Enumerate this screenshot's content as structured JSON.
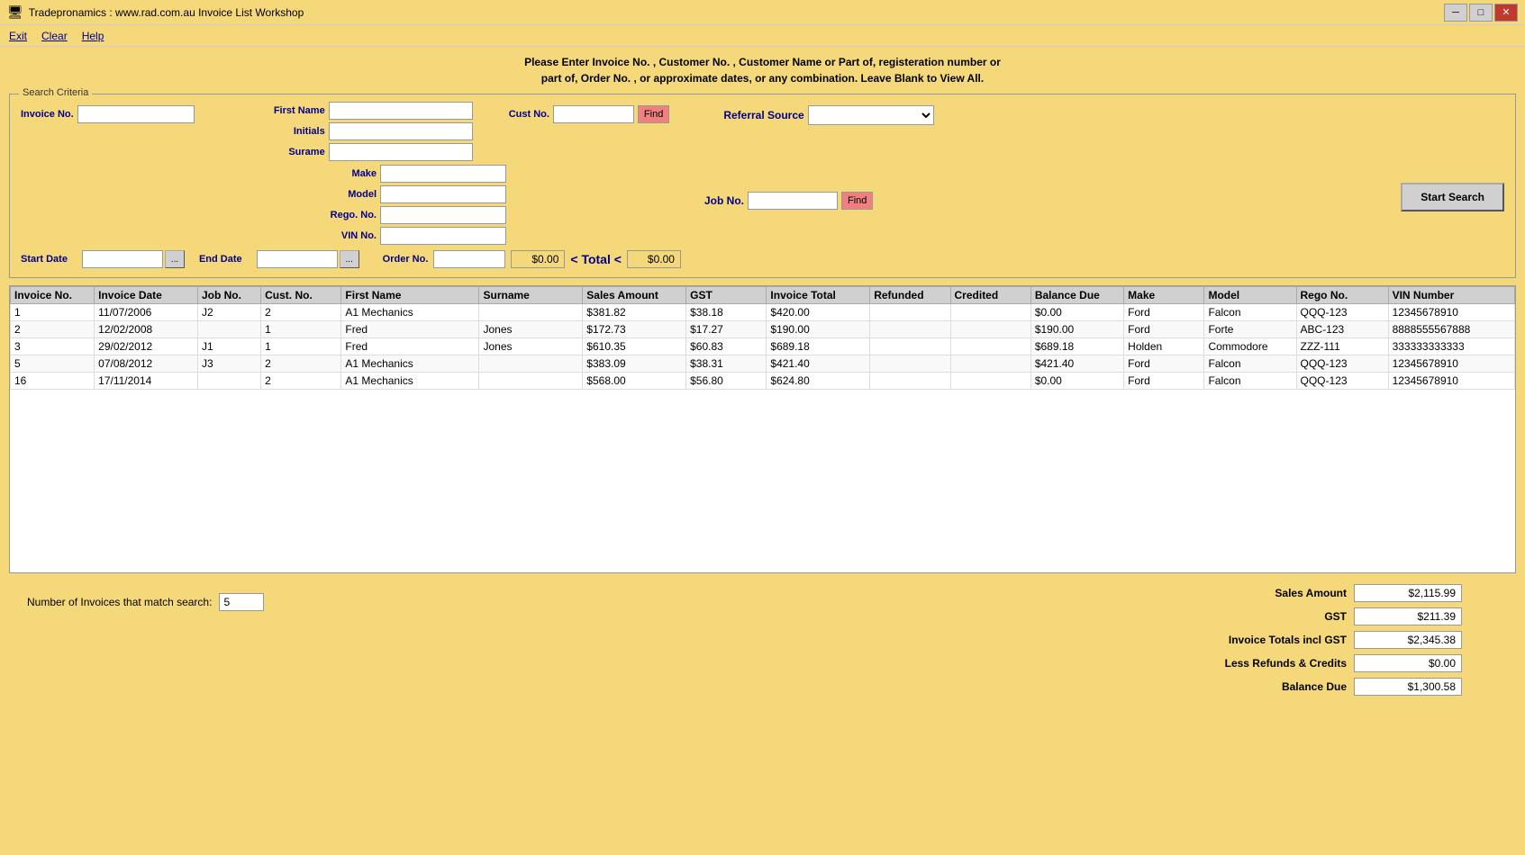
{
  "window": {
    "title": "Tradepronamics :   www.rad.com.au    Invoice List   Workshop",
    "icon": "app-icon"
  },
  "menu": {
    "items": [
      {
        "label": "Exit",
        "id": "exit"
      },
      {
        "label": "Clear",
        "id": "clear"
      },
      {
        "label": "Help",
        "id": "help"
      }
    ]
  },
  "instructions": {
    "line1": "Please Enter Invoice No. , Customer No. , Customer Name or Part of, registeration number or",
    "line2": "part of, Order No. , or approximate dates, or any combination. Leave Blank to View All."
  },
  "searchCriteria": {
    "label": "Search Criteria",
    "fields": {
      "invoiceNo": {
        "label": "Invoice No.",
        "value": "",
        "placeholder": ""
      },
      "firstName": {
        "label": "First Name",
        "value": "",
        "placeholder": ""
      },
      "initials": {
        "label": "Initials",
        "value": "",
        "placeholder": ""
      },
      "surname": {
        "label": "Surame",
        "value": "",
        "placeholder": ""
      },
      "custNo": {
        "label": "Cust No.",
        "value": "",
        "placeholder": ""
      },
      "findCust": {
        "label": "Find"
      },
      "referralSource": {
        "label": "Referral Source",
        "value": "",
        "options": []
      },
      "make": {
        "label": "Make",
        "value": ""
      },
      "model": {
        "label": "Model",
        "value": ""
      },
      "regoNo": {
        "label": "Rego. No.",
        "value": ""
      },
      "vinNo": {
        "label": "VIN No.",
        "value": ""
      },
      "jobNo": {
        "label": "Job No.",
        "value": ""
      },
      "findJob": {
        "label": "Find"
      },
      "startDate": {
        "label": "Start Date",
        "value": ""
      },
      "endDate": {
        "label": "End Date",
        "value": ""
      },
      "orderNo": {
        "label": "Order No.",
        "value": ""
      },
      "total1": {
        "value": "$0.00"
      },
      "totalLabel": "< Total <",
      "total2": {
        "value": "$0.00"
      }
    },
    "startSearchBtn": "Start Search"
  },
  "table": {
    "columns": [
      "Invoice No.",
      "Invoice Date",
      "Job No.",
      "Cust. No.",
      "First Name",
      "Surname",
      "Sales Amount",
      "GST",
      "Invoice Total",
      "Refunded",
      "Credited",
      "Balance Due",
      "Make",
      "Model",
      "Rego No.",
      "VIN Number"
    ],
    "rows": [
      {
        "invoiceNo": "1",
        "invoiceDate": "11/07/2006",
        "jobNo": "J2",
        "custNo": "2",
        "firstName": "A1 Mechanics",
        "surname": "",
        "salesAmount": "$381.82",
        "gst": "$38.18",
        "invoiceTotal": "$420.00",
        "refunded": "",
        "credited": "",
        "balanceDue": "$0.00",
        "make": "Ford",
        "model": "Falcon",
        "regoNo": "QQQ-123",
        "vinNumber": "12345678910"
      },
      {
        "invoiceNo": "2",
        "invoiceDate": "12/02/2008",
        "jobNo": "",
        "custNo": "1",
        "firstName": "Fred",
        "surname": "Jones",
        "salesAmount": "$172.73",
        "gst": "$17.27",
        "invoiceTotal": "$190.00",
        "refunded": "",
        "credited": "",
        "balanceDue": "$190.00",
        "make": "Ford",
        "model": "Forte",
        "regoNo": "ABC-123",
        "vinNumber": "8888555567888"
      },
      {
        "invoiceNo": "3",
        "invoiceDate": "29/02/2012",
        "jobNo": "J1",
        "custNo": "1",
        "firstName": "Fred",
        "surname": "Jones",
        "salesAmount": "$610.35",
        "gst": "$60.83",
        "invoiceTotal": "$689.18",
        "refunded": "",
        "credited": "",
        "balanceDue": "$689.18",
        "make": "Holden",
        "model": "Commodore",
        "regoNo": "ZZZ-111",
        "vinNumber": "333333333333"
      },
      {
        "invoiceNo": "5",
        "invoiceDate": "07/08/2012",
        "jobNo": "J3",
        "custNo": "2",
        "firstName": "A1 Mechanics",
        "surname": "",
        "salesAmount": "$383.09",
        "gst": "$38.31",
        "invoiceTotal": "$421.40",
        "refunded": "",
        "credited": "",
        "balanceDue": "$421.40",
        "make": "Ford",
        "model": "Falcon",
        "regoNo": "QQQ-123",
        "vinNumber": "12345678910"
      },
      {
        "invoiceNo": "16",
        "invoiceDate": "17/11/2014",
        "jobNo": "",
        "custNo": "2",
        "firstName": "A1 Mechanics",
        "surname": "",
        "salesAmount": "$568.00",
        "gst": "$56.80",
        "invoiceTotal": "$624.80",
        "refunded": "",
        "credited": "",
        "balanceDue": "$0.00",
        "make": "Ford",
        "model": "Falcon",
        "regoNo": "QQQ-123",
        "vinNumber": "12345678910"
      }
    ]
  },
  "summary": {
    "matchCount": {
      "label": "Number of Invoices that match search:",
      "value": "5"
    },
    "salesAmount": {
      "label": "Sales Amount",
      "value": "$2,115.99"
    },
    "gst": {
      "label": "GST",
      "value": "$211.39"
    },
    "invoiceTotals": {
      "label": "Invoice Totals incl GST",
      "value": "$2,345.38"
    },
    "lessRefunds": {
      "label": "Less Refunds & Credits",
      "value": "$0.00"
    },
    "balanceDue": {
      "label": "Balance Due",
      "value": "$1,300.58"
    }
  }
}
